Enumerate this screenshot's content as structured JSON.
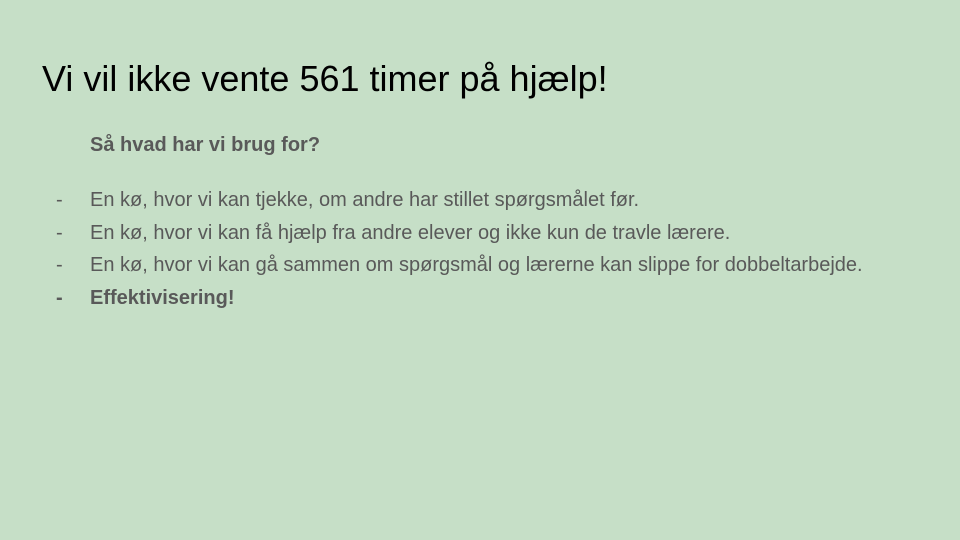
{
  "slide": {
    "title": "Vi vil ikke vente 561 timer på hjælp!",
    "subheading": "Så hvad har vi brug for?",
    "bullets": [
      {
        "marker": "-",
        "text": "En kø, hvor vi kan tjekke, om andre har stillet spørgsmålet før."
      },
      {
        "marker": "-",
        "text": "En kø, hvor vi kan få hjælp fra andre elever og ikke kun de travle lærere."
      },
      {
        "marker": "-",
        "text": "En kø, hvor vi kan gå sammen om spørgsmål og lærerne kan slippe for dobbeltarbejde."
      },
      {
        "marker": "-",
        "text": "Effektivisering!"
      }
    ]
  },
  "colors": {
    "background": "#c6dfc7",
    "title": "#000000",
    "body_text": "#595959"
  }
}
